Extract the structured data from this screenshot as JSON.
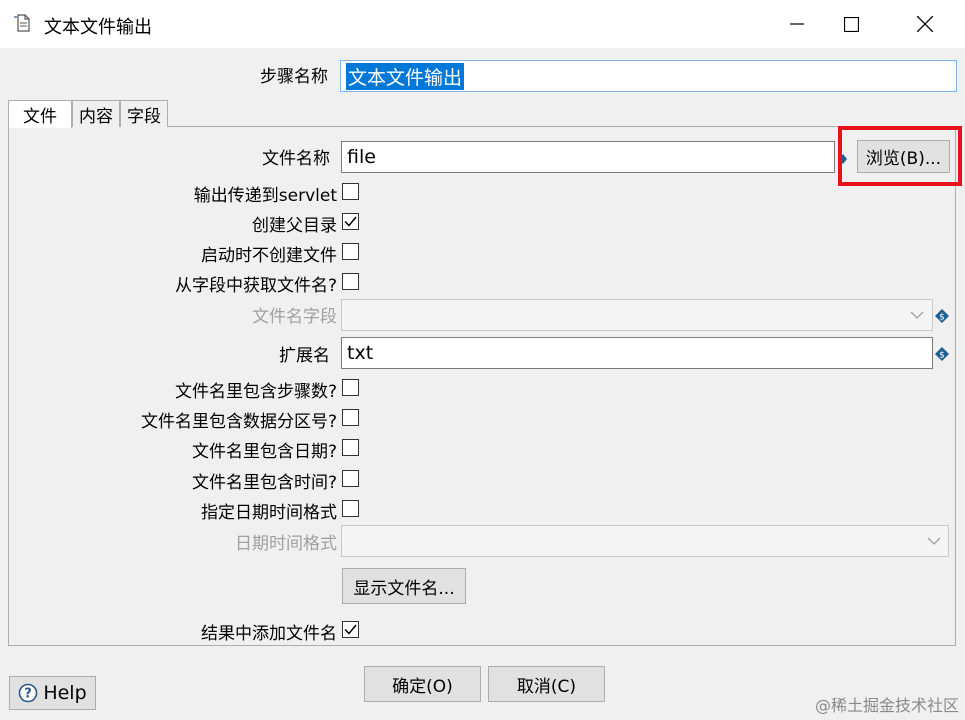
{
  "window": {
    "title": "文本文件输出",
    "minimize_icon": "minimize-icon",
    "maximize_icon": "maximize-icon",
    "close_icon": "close-icon"
  },
  "step_name": {
    "label": "步骤名称",
    "value": "文本文件输出"
  },
  "tabs": [
    {
      "label": "文件"
    },
    {
      "label": "内容"
    },
    {
      "label": "字段"
    }
  ],
  "file": {
    "filename_label": "文件名称",
    "filename_value": "file",
    "browse_label": "浏览(B)...",
    "servlet_label": "输出传递到servlet",
    "servlet_checked": false,
    "create_parent_label": "创建父目录",
    "create_parent_checked": true,
    "no_create_label": "启动时不创建文件",
    "no_create_checked": false,
    "from_field_label": "从字段中获取文件名?",
    "from_field_checked": false,
    "field_name_label": "文件名字段",
    "field_name_value": "",
    "extension_label": "扩展名",
    "extension_value": "txt",
    "include_stepnr_label": "文件名里包含步骤数?",
    "include_stepnr_checked": false,
    "include_partition_label": "文件名里包含数据分区号?",
    "include_partition_checked": false,
    "include_date_label": "文件名里包含日期?",
    "include_date_checked": false,
    "include_time_label": "文件名里包含时间?",
    "include_time_checked": false,
    "specify_format_label": "指定日期时间格式",
    "specify_format_checked": false,
    "datetime_format_label": "日期时间格式",
    "datetime_format_value": "",
    "show_filename_label": "显示文件名...",
    "add_to_result_label": "结果中添加文件名",
    "add_to_result_checked": true
  },
  "footer": {
    "help_label": "Help",
    "ok_label": "确定(O)",
    "cancel_label": "取消(C)",
    "watermark": "@稀土掘金技术社区"
  },
  "colors": {
    "highlight_box": "#e8121c",
    "selection_bg": "#0078d7",
    "variable_icon": "#1e5f8f"
  }
}
